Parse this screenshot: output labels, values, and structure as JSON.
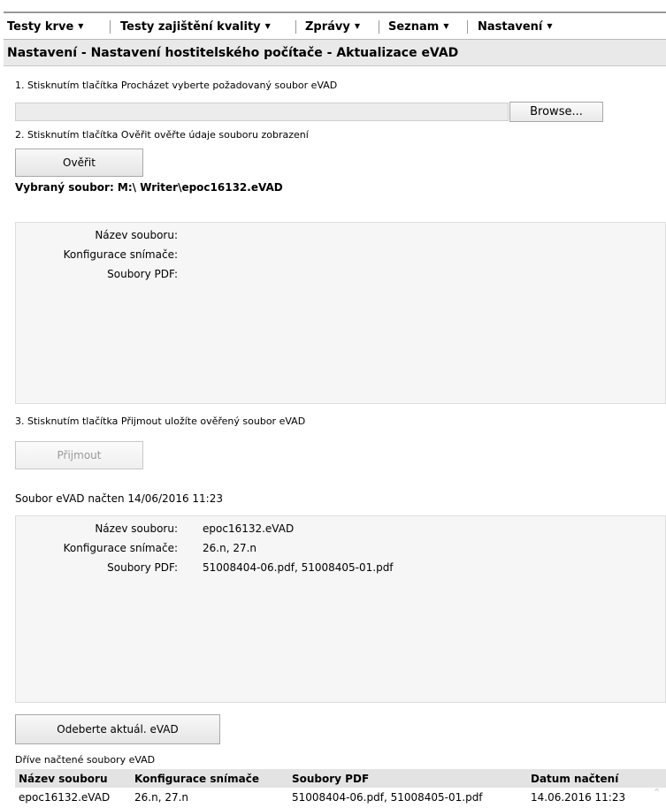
{
  "menu": [
    {
      "label": "Testy krve"
    },
    {
      "label": "Testy zajištění kvality"
    },
    {
      "label": "Zprávy"
    },
    {
      "label": "Seznam"
    },
    {
      "label": "Nastavení"
    }
  ],
  "page_title": "Nastavení - Nastavení hostitelského počítače - Aktualizace eVAD",
  "step1": {
    "text": "1. Stisknutím tlačítka Procházet vyberte požadovaný soubor eVAD",
    "file_value": "",
    "browse_label": "Browse..."
  },
  "step2": {
    "text": "2. Stisknutím tlačítka Ověřit ověřte údaje souboru zobrazení",
    "verify_label": "Ověřit",
    "selected_file": "Vybraný soubor: M:\\ Writer\\epoc16132.eVAD"
  },
  "verify_panel": {
    "file_name_label": "Název souboru:",
    "sensor_config_label": "Konfigurace snímače:",
    "pdf_files_label": "Soubory PDF:",
    "file_name": "",
    "sensor_config": "",
    "pdf_files": ""
  },
  "step3": {
    "text": "3. Stisknutím tlačítka Přijmout uložíte ověřený soubor eVAD",
    "accept_label": "Přijmout",
    "accept_enabled": false
  },
  "loaded_info": "Soubor eVAD načten 14/06/2016 11:23",
  "current_panel": {
    "file_name_label": "Název souboru:",
    "sensor_config_label": "Konfigurace snímače:",
    "pdf_files_label": "Soubory PDF:",
    "file_name": "epoc16132.eVAD",
    "sensor_config": "26.n, 27.n",
    "pdf_files": "51008404-06.pdf, 51008405-01.pdf"
  },
  "remove_label": "Odeberte aktuál. eVAD",
  "history": {
    "caption": "Dříve načtené soubory eVAD",
    "columns": [
      "Název souboru",
      "Konfigurace snímače",
      "Soubory PDF",
      "Datum načtení"
    ],
    "rows": [
      [
        "epoc16132.eVAD",
        "26.n, 27.n",
        "51008404-06.pdf, 51008405-01.pdf",
        "14.06.2016 11:23"
      ]
    ]
  },
  "icons": {
    "menu_caret": "chevron-down-icon",
    "scroll_up": "chevron-up-icon"
  }
}
